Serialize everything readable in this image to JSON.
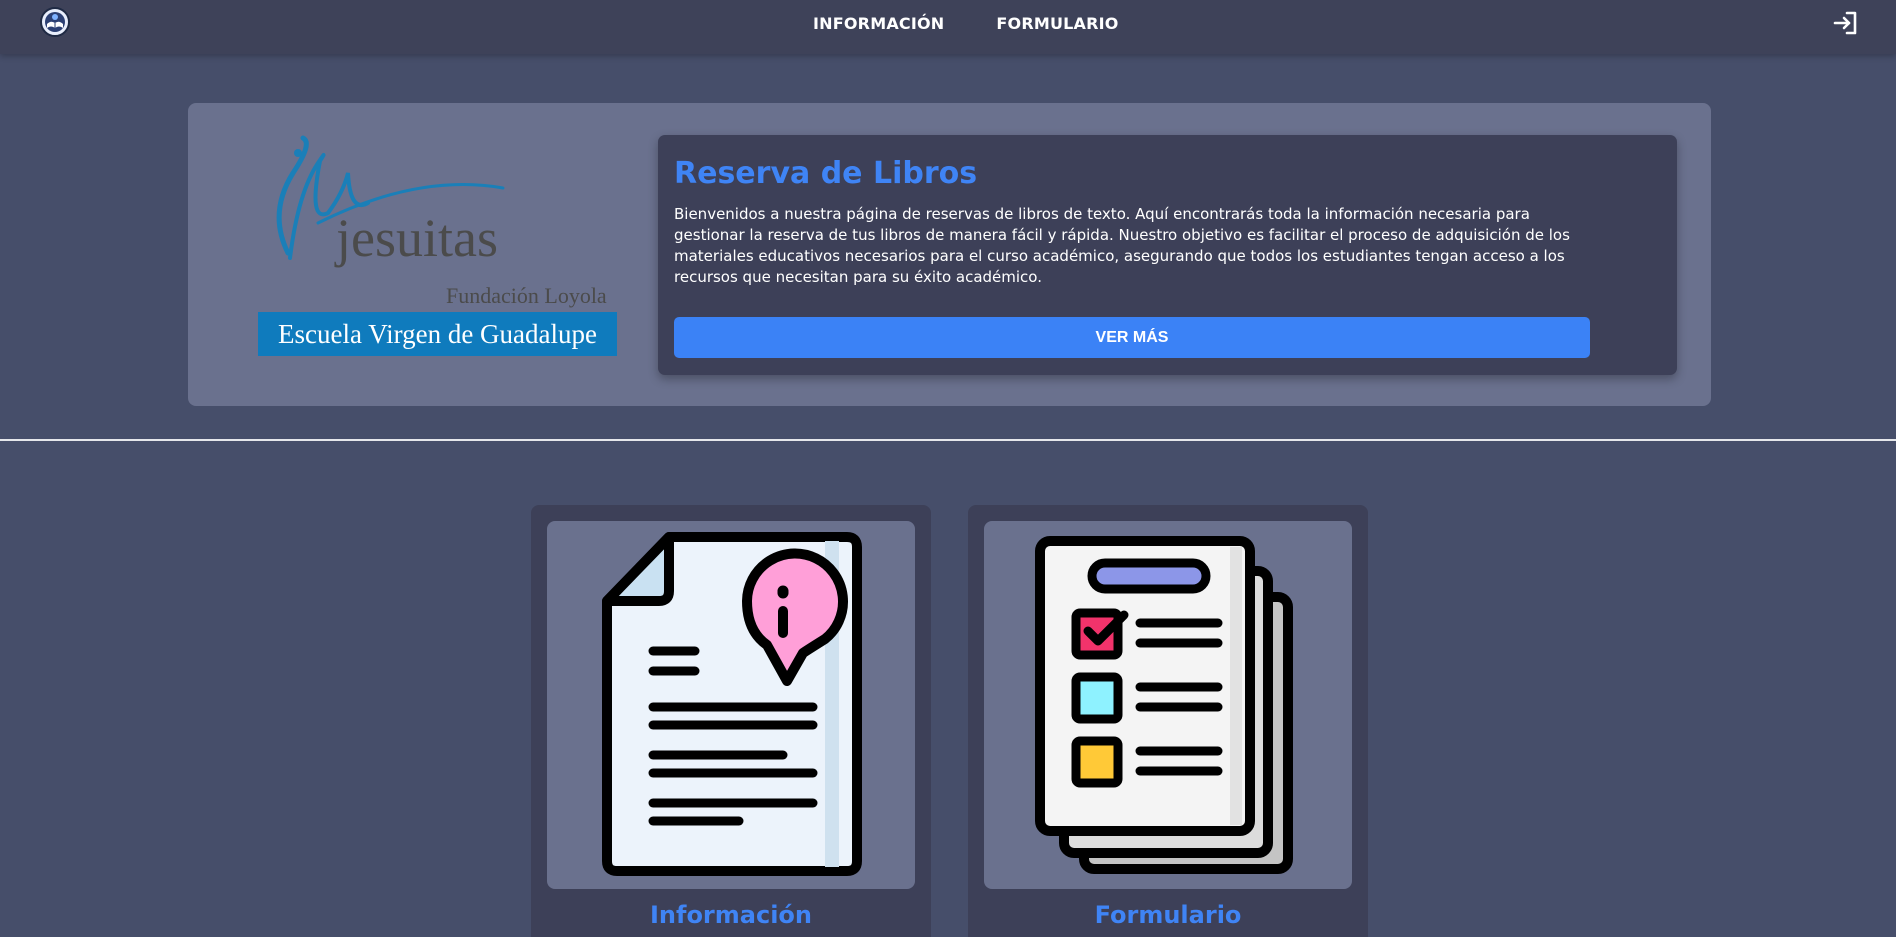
{
  "nav": {
    "links": [
      "INFORMACIÓN",
      "FORMULARIO"
    ],
    "logo_icon": "book-globe-icon",
    "login_icon": "sign-in-icon"
  },
  "hero": {
    "logo_text_main": "jesuitas",
    "logo_text_sub": "Fundación Loyola",
    "logo_banner": "Escuela Virgen de Guadalupe",
    "title": "Reserva de Libros",
    "description": "Bienvenidos a nuestra página de reservas de libros de texto. Aquí encontrarás toda la información necesaria para gestionar la reserva de tus libros de manera fácil y rápida. Nuestro objetivo es facilitar el proceso de adquisición de los materiales educativos necesarios para el curso académico, asegurando que todos los estudiantes tengan acceso a los recursos que necesitan para su éxito académico.",
    "button_label": "VER MÁS"
  },
  "cards": [
    {
      "title": "Información",
      "icon": "info-document-icon"
    },
    {
      "title": "Formulario",
      "icon": "checklist-form-icon"
    }
  ],
  "colors": {
    "accent": "#3b82f6",
    "background": "#464e6a",
    "navbar": "#3e4259",
    "card": "#3d4058"
  }
}
